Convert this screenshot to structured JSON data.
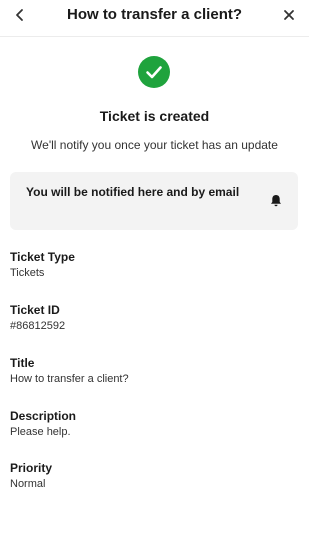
{
  "header": {
    "title": "How to transfer a client?",
    "back_icon": "chevron-left-icon",
    "close_icon": "close-icon"
  },
  "status": {
    "icon": "check-circle-icon",
    "color": "#1fa33d",
    "heading": "Ticket is created",
    "message": "We'll notify you once your ticket has an update"
  },
  "notification_card": {
    "text": "You will be notified here and by email",
    "icon": "bell-icon"
  },
  "fields": [
    {
      "label": "Ticket Type",
      "value": "Tickets"
    },
    {
      "label": "Ticket ID",
      "value": "#86812592"
    },
    {
      "label": "Title",
      "value": "How to transfer a client?"
    },
    {
      "label": "Description",
      "value": "Please help."
    },
    {
      "label": "Priority",
      "value": "Normal"
    }
  ]
}
